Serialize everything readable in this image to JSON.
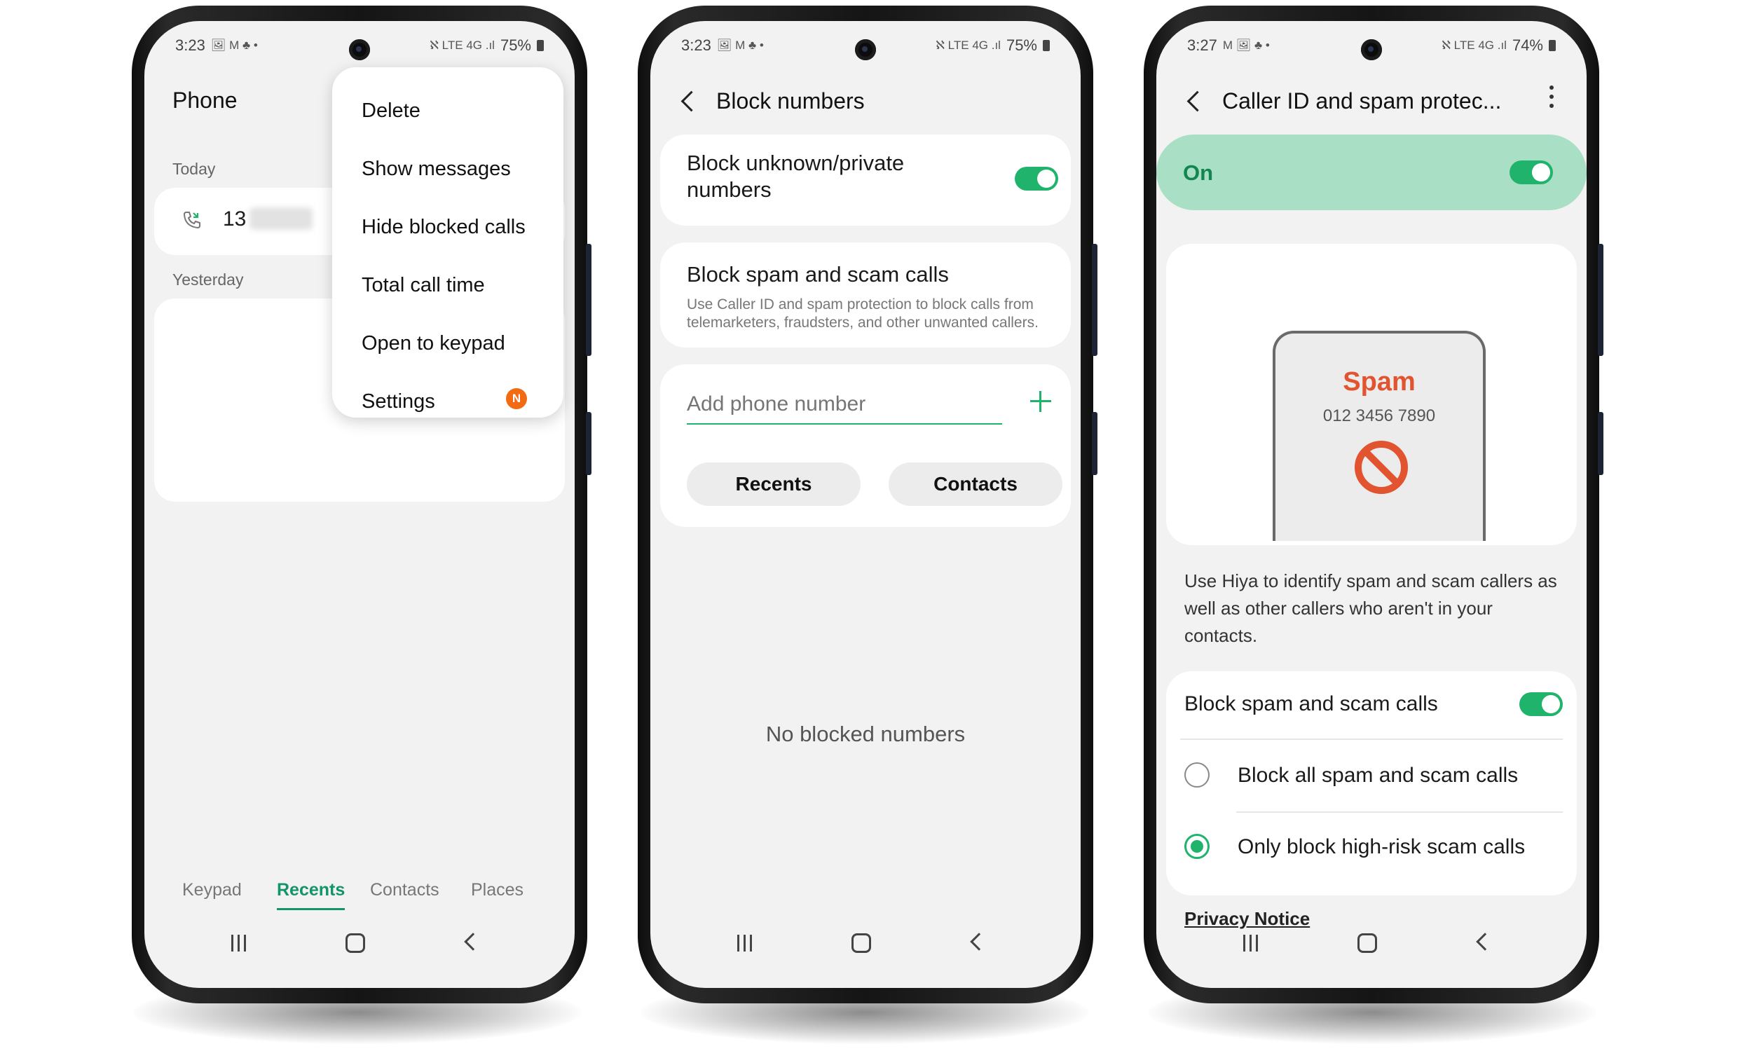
{
  "accent_color": "#1fb36b",
  "phone1": {
    "status": {
      "time": "3:23",
      "icons": "🖼 M ♣ •",
      "signal": "ℵ LTE 4G .ıl",
      "battery": "75%"
    },
    "title": "Phone",
    "today_label": "Today",
    "call_entry_number": "13",
    "yesterday_label": "Yesterday",
    "menu": [
      {
        "label": "Delete"
      },
      {
        "label": "Show messages"
      },
      {
        "label": "Hide blocked calls"
      },
      {
        "label": "Total call time"
      },
      {
        "label": "Open to keypad"
      },
      {
        "label": "Settings",
        "badge": "N"
      }
    ],
    "tabs": [
      "Keypad",
      "Recents",
      "Contacts",
      "Places"
    ],
    "active_tab": "Recents"
  },
  "phone2": {
    "status": {
      "time": "3:23",
      "icons": "🖼 M ♣ •",
      "signal": "ℵ LTE 4G .ıl",
      "battery": "75%"
    },
    "title": "Block numbers",
    "block_unknown_label": "Block unknown/private numbers",
    "block_unknown_on": true,
    "block_spam_title": "Block spam and scam calls",
    "block_spam_desc": "Use Caller ID and spam protection to block calls from telemarketers, fraudsters, and other unwanted callers.",
    "add_placeholder": "Add phone number",
    "recents_btn": "Recents",
    "contacts_btn": "Contacts",
    "empty_text": "No blocked numbers"
  },
  "phone3": {
    "status": {
      "time": "3:27",
      "icons": "M 🖼 ♣ •",
      "signal": "ℵ LTE 4G .ıl",
      "battery": "74%"
    },
    "title": "Caller ID and spam protec...",
    "on_label": "On",
    "master_on": true,
    "illustration": {
      "label": "Spam",
      "number": "012 3456 7890"
    },
    "description": "Use Hiya to identify spam and scam callers as well as other callers who aren't in your contacts.",
    "block_spam_label": "Block spam and scam calls",
    "block_spam_on": true,
    "options": [
      {
        "label": "Block all spam and scam calls",
        "selected": false
      },
      {
        "label": "Only block high-risk scam calls",
        "selected": true
      }
    ],
    "privacy_notice": "Privacy Notice"
  }
}
